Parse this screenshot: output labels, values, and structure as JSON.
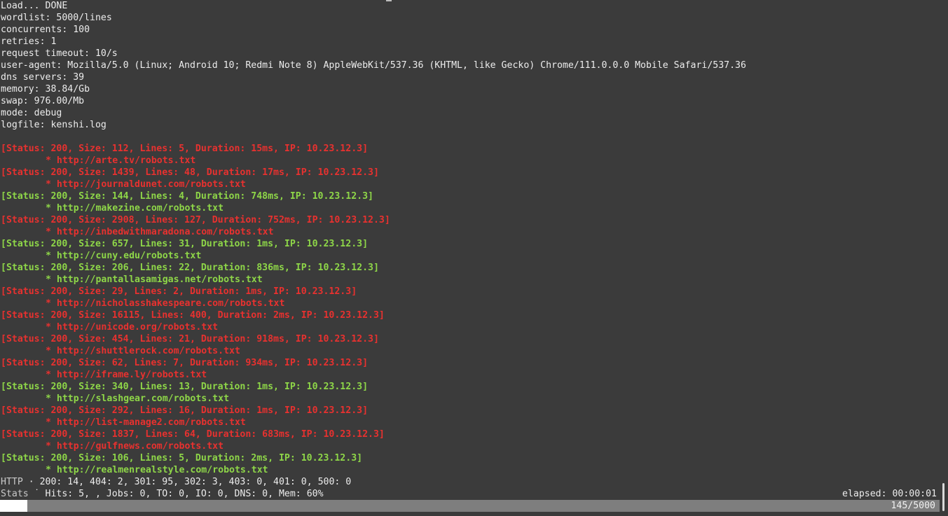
{
  "config": [
    {
      "name": "load-status",
      "text": "Load... DONE"
    },
    {
      "name": "wordlist",
      "text": "wordlist: 5000/lines"
    },
    {
      "name": "concurrents",
      "text": "concurrents: 100"
    },
    {
      "name": "retries",
      "text": "retries: 1"
    },
    {
      "name": "request-timeout",
      "text": "request timeout: 10/s"
    },
    {
      "name": "user-agent",
      "text": "user-agent: Mozilla/5.0 (Linux; Android 10; Redmi Note 8) AppleWebKit/537.36 (KHTML, like Gecko) Chrome/111.0.0.0 Mobile Safari/537.36"
    },
    {
      "name": "dns-servers",
      "text": "dns servers: 39"
    },
    {
      "name": "memory",
      "text": "memory: 38.84/Gb"
    },
    {
      "name": "swap",
      "text": "swap: 976.00/Mb"
    },
    {
      "name": "mode",
      "text": "mode: debug"
    },
    {
      "name": "logfile",
      "text": "logfile: kenshi.log"
    }
  ],
  "results": [
    {
      "status": "[Status: 200, Size: 112, Lines: 5, Duration: 15ms, IP: 10.23.12.3]",
      "url": "* http://arte.tv/robots.txt",
      "color": "red"
    },
    {
      "status": "[Status: 200, Size: 1439, Lines: 48, Duration: 17ms, IP: 10.23.12.3]",
      "url": "* http://journaldunet.com/robots.txt",
      "color": "red"
    },
    {
      "status": "[Status: 200, Size: 144, Lines: 4, Duration: 748ms, IP: 10.23.12.3]",
      "url": "* http://makezine.com/robots.txt",
      "color": "green"
    },
    {
      "status": "[Status: 200, Size: 2908, Lines: 127, Duration: 752ms, IP: 10.23.12.3]",
      "url": "* http://inbedwithmaradona.com/robots.txt",
      "color": "red"
    },
    {
      "status": "[Status: 200, Size: 657, Lines: 31, Duration: 1ms, IP: 10.23.12.3]",
      "url": "* http://cuny.edu/robots.txt",
      "color": "green"
    },
    {
      "status": "[Status: 200, Size: 206, Lines: 22, Duration: 836ms, IP: 10.23.12.3]",
      "url": "* http://pantallasamigas.net/robots.txt",
      "color": "green"
    },
    {
      "status": "[Status: 200, Size: 29, Lines: 2, Duration: 1ms, IP: 10.23.12.3]",
      "url": "* http://nicholasshakespeare.com/robots.txt",
      "color": "red"
    },
    {
      "status": "[Status: 200, Size: 16115, Lines: 400, Duration: 2ms, IP: 10.23.12.3]",
      "url": "* http://unicode.org/robots.txt",
      "color": "red"
    },
    {
      "status": "[Status: 200, Size: 454, Lines: 21, Duration: 918ms, IP: 10.23.12.3]",
      "url": "* http://shuttlerock.com/robots.txt",
      "color": "red"
    },
    {
      "status": "[Status: 200, Size: 62, Lines: 7, Duration: 934ms, IP: 10.23.12.3]",
      "url": "* http://iframe.ly/robots.txt",
      "color": "red"
    },
    {
      "status": "[Status: 200, Size: 340, Lines: 13, Duration: 1ms, IP: 10.23.12.3]",
      "url": "* http://slashgear.com/robots.txt",
      "color": "green"
    },
    {
      "status": "[Status: 200, Size: 292, Lines: 16, Duration: 1ms, IP: 10.23.12.3]",
      "url": "* http://list-manage2.com/robots.txt",
      "color": "red"
    },
    {
      "status": "[Status: 200, Size: 1837, Lines: 64, Duration: 683ms, IP: 10.23.12.3]",
      "url": "* http://gulfnews.com/robots.txt",
      "color": "red"
    },
    {
      "status": "[Status: 200, Size: 106, Lines: 5, Duration: 2ms, IP: 10.23.12.3]",
      "url": "* http://realmenrealstyle.com/robots.txt",
      "color": "green"
    }
  ],
  "footer": {
    "http_label": "HTTP",
    "http_sep": " · ",
    "http_text": "200: 14, 404: 2, 301: 95, 302: 3, 403: 0, 401: 0, 500: 0",
    "stats_label": "Stats",
    "stats_sep": " ˙ ",
    "stats_text": "Hits: 5, , Jobs: 0, TO: 0, IO: 0, DNS: 0, Mem: 60%",
    "elapsed": "elapsed: 00:00:01"
  },
  "progress": {
    "done": 145,
    "total": 5000,
    "label": "145/5000"
  },
  "colors": {
    "background": "#3b3b3b",
    "text": "#ececec",
    "red": "#e8312f",
    "green": "#8ed648",
    "progress_track": "#7e7e7e",
    "progress_fill": "#ffffff"
  }
}
